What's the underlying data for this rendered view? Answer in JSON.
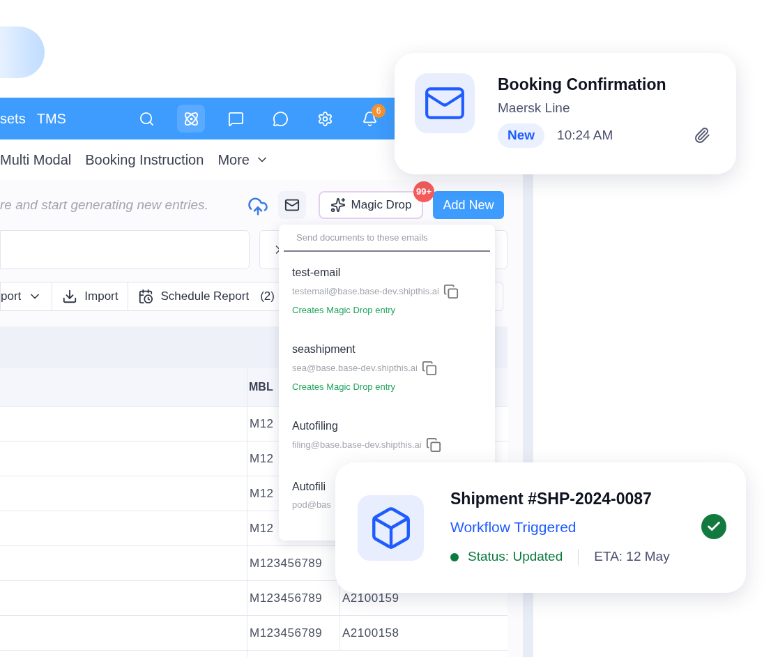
{
  "top_bar": {
    "nav_items": [
      "sets",
      "TMS"
    ],
    "icons": [
      {
        "kind": "search",
        "selected": false
      },
      {
        "kind": "atom",
        "selected": true
      },
      {
        "kind": "chat",
        "selected": false
      },
      {
        "kind": "whatsapp",
        "selected": false
      },
      {
        "kind": "settings",
        "selected": false
      },
      {
        "kind": "bell",
        "selected": false,
        "badge": "6"
      }
    ]
  },
  "tabs": [
    {
      "label": "Multi Modal",
      "has_menu": false
    },
    {
      "label": "Booking Instruction",
      "has_menu": false
    },
    {
      "label": "More",
      "has_menu": true
    }
  ],
  "toolbar": {
    "hint": "re and start generating new entries.",
    "magic_drop": {
      "label": "Magic Drop",
      "badge": "99+"
    },
    "add_button": "Add New"
  },
  "actions": [
    {
      "kind": "dropdown",
      "label": "port"
    },
    {
      "kind": "import",
      "label": "Import"
    },
    {
      "kind": "schedule",
      "label": "Schedule Report",
      "count": "(2)"
    }
  ],
  "table": {
    "columns": [
      "MBL"
    ],
    "rows": [
      [
        "M12"
      ],
      [
        "M12"
      ],
      [
        "M12"
      ],
      [
        "M12"
      ],
      [
        "M123456789"
      ],
      [
        "M123456789",
        "A2100159"
      ],
      [
        "M123456789",
        "A2100158"
      ]
    ]
  },
  "email_dropdown": {
    "placeholder": "Send documents to these emails",
    "entries": [
      {
        "name": "test-email",
        "email": "testemail@base.base-dev.shipthis.ai",
        "note": "Creates Magic Drop entry",
        "copy_icon": true
      },
      {
        "name": "seashipment",
        "email": "sea@base.base-dev.shipthis.ai",
        "note": "Creates Magic Drop entry",
        "copy_icon": true
      },
      {
        "name": "Autofiling",
        "email": "filing@base.base-dev.shipthis.ai",
        "copy_icon": true
      },
      {
        "name": "Autofili",
        "email": "pod@bas"
      }
    ]
  },
  "notifications": [
    {
      "kind": "email",
      "title": "Booking Confirmation",
      "subtitle": "Maersk Line",
      "tag": "New",
      "time": "10:24 AM",
      "attachment": true
    },
    {
      "kind": "shipment",
      "title": "Shipment #SHP-2024-0087",
      "subtitle": "Workflow Triggered",
      "status": "Status: Updated",
      "eta": "ETA: 12 May",
      "done": true
    }
  ]
}
